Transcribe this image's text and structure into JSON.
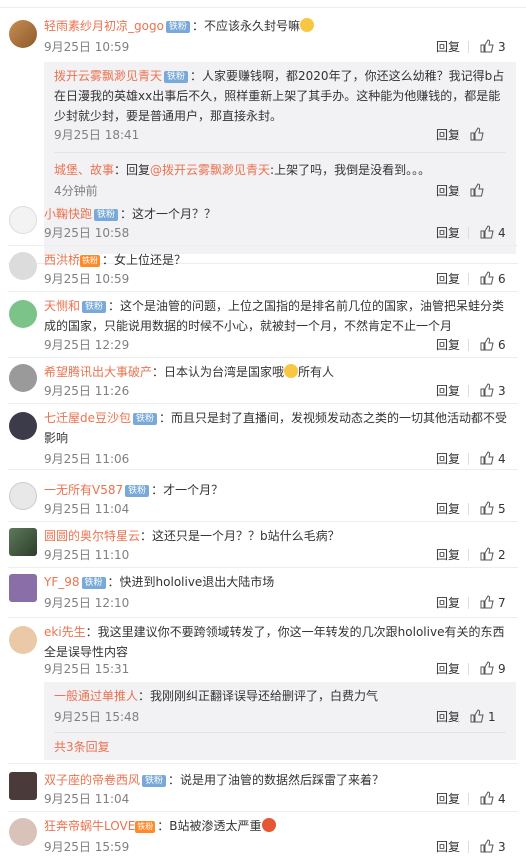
{
  "colors": {
    "username": "#eb7350",
    "badge": "#79a9d8",
    "vip": "#ff8a2b",
    "meta": "#808080",
    "subbg": "#f2f2f5"
  },
  "icons": {
    "like": "thumbs-up-icon",
    "badge": "fans-badge-icon"
  },
  "ui": {
    "reply_label": "回复",
    "badge_label": "铁粉",
    "vip_label": "铁粉"
  },
  "comments": [
    {
      "user": "轻雨素纱月初凉_gogo",
      "text": "：不应该永久封号嘛",
      "time": "9月25日 10:59",
      "likes": "3"
    },
    {
      "user": "小鞠快跑",
      "text": "：这才一个月？？",
      "time": "9月25日 10:58",
      "likes": "4"
    },
    {
      "user": "西洪桥",
      "text": "：女上位还是？",
      "time": "9月25日 10:59",
      "likes": "6"
    },
    {
      "user": "天恻和",
      "text": "：这个是油管的问题，上位之国指的是排名前几位的国家，油管把呆蛙分类成的国家，只能说用数据的时候不小心，就被封一个月，不然肯定不止一个月",
      "time": "9月25日 12:29",
      "likes": "6"
    },
    {
      "user": "希望腾讯出大事破产",
      "text": "：日本认为台湾是国家哦",
      "text2": "所有人",
      "time": "9月25日 11:26",
      "likes": "3"
    },
    {
      "user": "七迁屋de豆沙包",
      "text": "：而且只是封了直播间，发视频发动态之类的一切其他活动都不受影响",
      "time": "9月25日 11:06",
      "likes": "4"
    },
    {
      "user": "一无所有V587",
      "text": "：才一个月？",
      "time": "9月25日 11:04",
      "likes": "5"
    },
    {
      "user": "圆圆的奥尔特星云",
      "text": "：这还只是一个月？？b站什么毛病？",
      "time": "9月25日 11:10",
      "likes": "2"
    },
    {
      "user": "YF_98",
      "text": "：快进到hololive退出大陆市场",
      "time": "9月25日 12:10",
      "likes": "7"
    },
    {
      "user": "eki先生",
      "text": "：我这里建议你不要跨领域转发了，你这一年转发的几次跟hololive有关的东西全是误导性内容",
      "time": "9月25日 15:31",
      "likes": "9"
    },
    {
      "user": "双子座的帝卷西风",
      "text": "：说是用了油管的数据然后踩雷了来着？",
      "time": "9月25日 11:04",
      "likes": "4"
    },
    {
      "user": "狂奔帝蜗牛LOVE",
      "text": "：B站被渗透太严重",
      "time": "9月25日 15:59",
      "likes": "3"
    }
  ],
  "replies": {
    "r1": {
      "user": "拨开云雾飘渺见青天",
      "text": "：人家要赚钱啊，都2020年了，你还这么幼稚？我记得b占在日漫我的英雄xx出事后不久，照样重新上架了其手办。这种能为他赚钱的，都是能少封就少封，要是普通用户，那直接永封。",
      "time": "9月25日 18:41"
    },
    "r2": {
      "user": "城堡、故事",
      "text": "：回复",
      "mention": "@拨开云雾飘渺见青天",
      "text2": ":上架了吗，我倒是没看到。。。",
      "time": "4分钟前"
    },
    "r3": {
      "user": "一般通过单推人",
      "text": "：我刚刚纠正翻译误导还给删评了，白费力气",
      "time": "9月25日 15:48",
      "likes": "1"
    },
    "more": "共3条回复"
  }
}
